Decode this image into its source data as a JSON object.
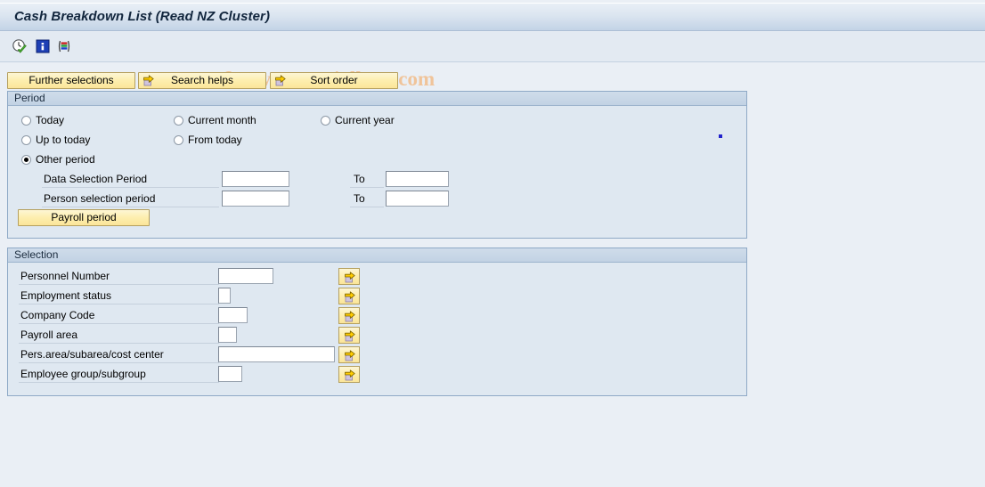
{
  "window": {
    "title": "Cash Breakdown List (Read NZ Cluster)"
  },
  "watermark": {
    "text": "© www.tutorialkart.com"
  },
  "toolbar": {
    "icons": [
      {
        "name": "execute-clock-icon",
        "label": "Execute"
      },
      {
        "name": "information-icon",
        "label": "Information"
      },
      {
        "name": "color-list-icon",
        "label": "List"
      }
    ]
  },
  "action_buttons": [
    {
      "name": "further-selections-button",
      "label": "Further selections",
      "has_arrow": false
    },
    {
      "name": "search-helps-button",
      "label": "Search helps",
      "has_arrow": true
    },
    {
      "name": "sort-order-button",
      "label": "Sort order",
      "has_arrow": true
    }
  ],
  "period": {
    "header": "Period",
    "radios": [
      {
        "label": "Today",
        "checked": false
      },
      {
        "label": "Current month",
        "checked": false
      },
      {
        "label": "Current year",
        "checked": false
      },
      {
        "label": "Up to today",
        "checked": false
      },
      {
        "label": "From today",
        "checked": false
      },
      {
        "label": "Other period",
        "checked": true
      }
    ],
    "fields": [
      {
        "label": "Data Selection Period",
        "value": "",
        "to_label": "To",
        "to_value": ""
      },
      {
        "label": "Person selection period",
        "value": "",
        "to_label": "To",
        "to_value": ""
      }
    ],
    "payroll_period_button": "Payroll period"
  },
  "selection": {
    "header": "Selection",
    "rows": [
      {
        "label": "Personnel Number",
        "value": ""
      },
      {
        "label": "Employment status",
        "value": ""
      },
      {
        "label": "Company Code",
        "value": ""
      },
      {
        "label": "Payroll area",
        "value": ""
      },
      {
        "label": "Pers.area/subarea/cost center",
        "value": ""
      },
      {
        "label": "Employee group/subgroup",
        "value": ""
      }
    ],
    "multi_select_icon": "multi-select-arrow-icon"
  },
  "colors": {
    "page_background": "#eaeff5",
    "panel_background": "#dfe8f1",
    "panel_border": "#8fa9c6",
    "button_yellow": "#fdeeae",
    "title_text": "#12263d",
    "watermark": "#f0c49a",
    "marker_dot": "#2222cc"
  }
}
